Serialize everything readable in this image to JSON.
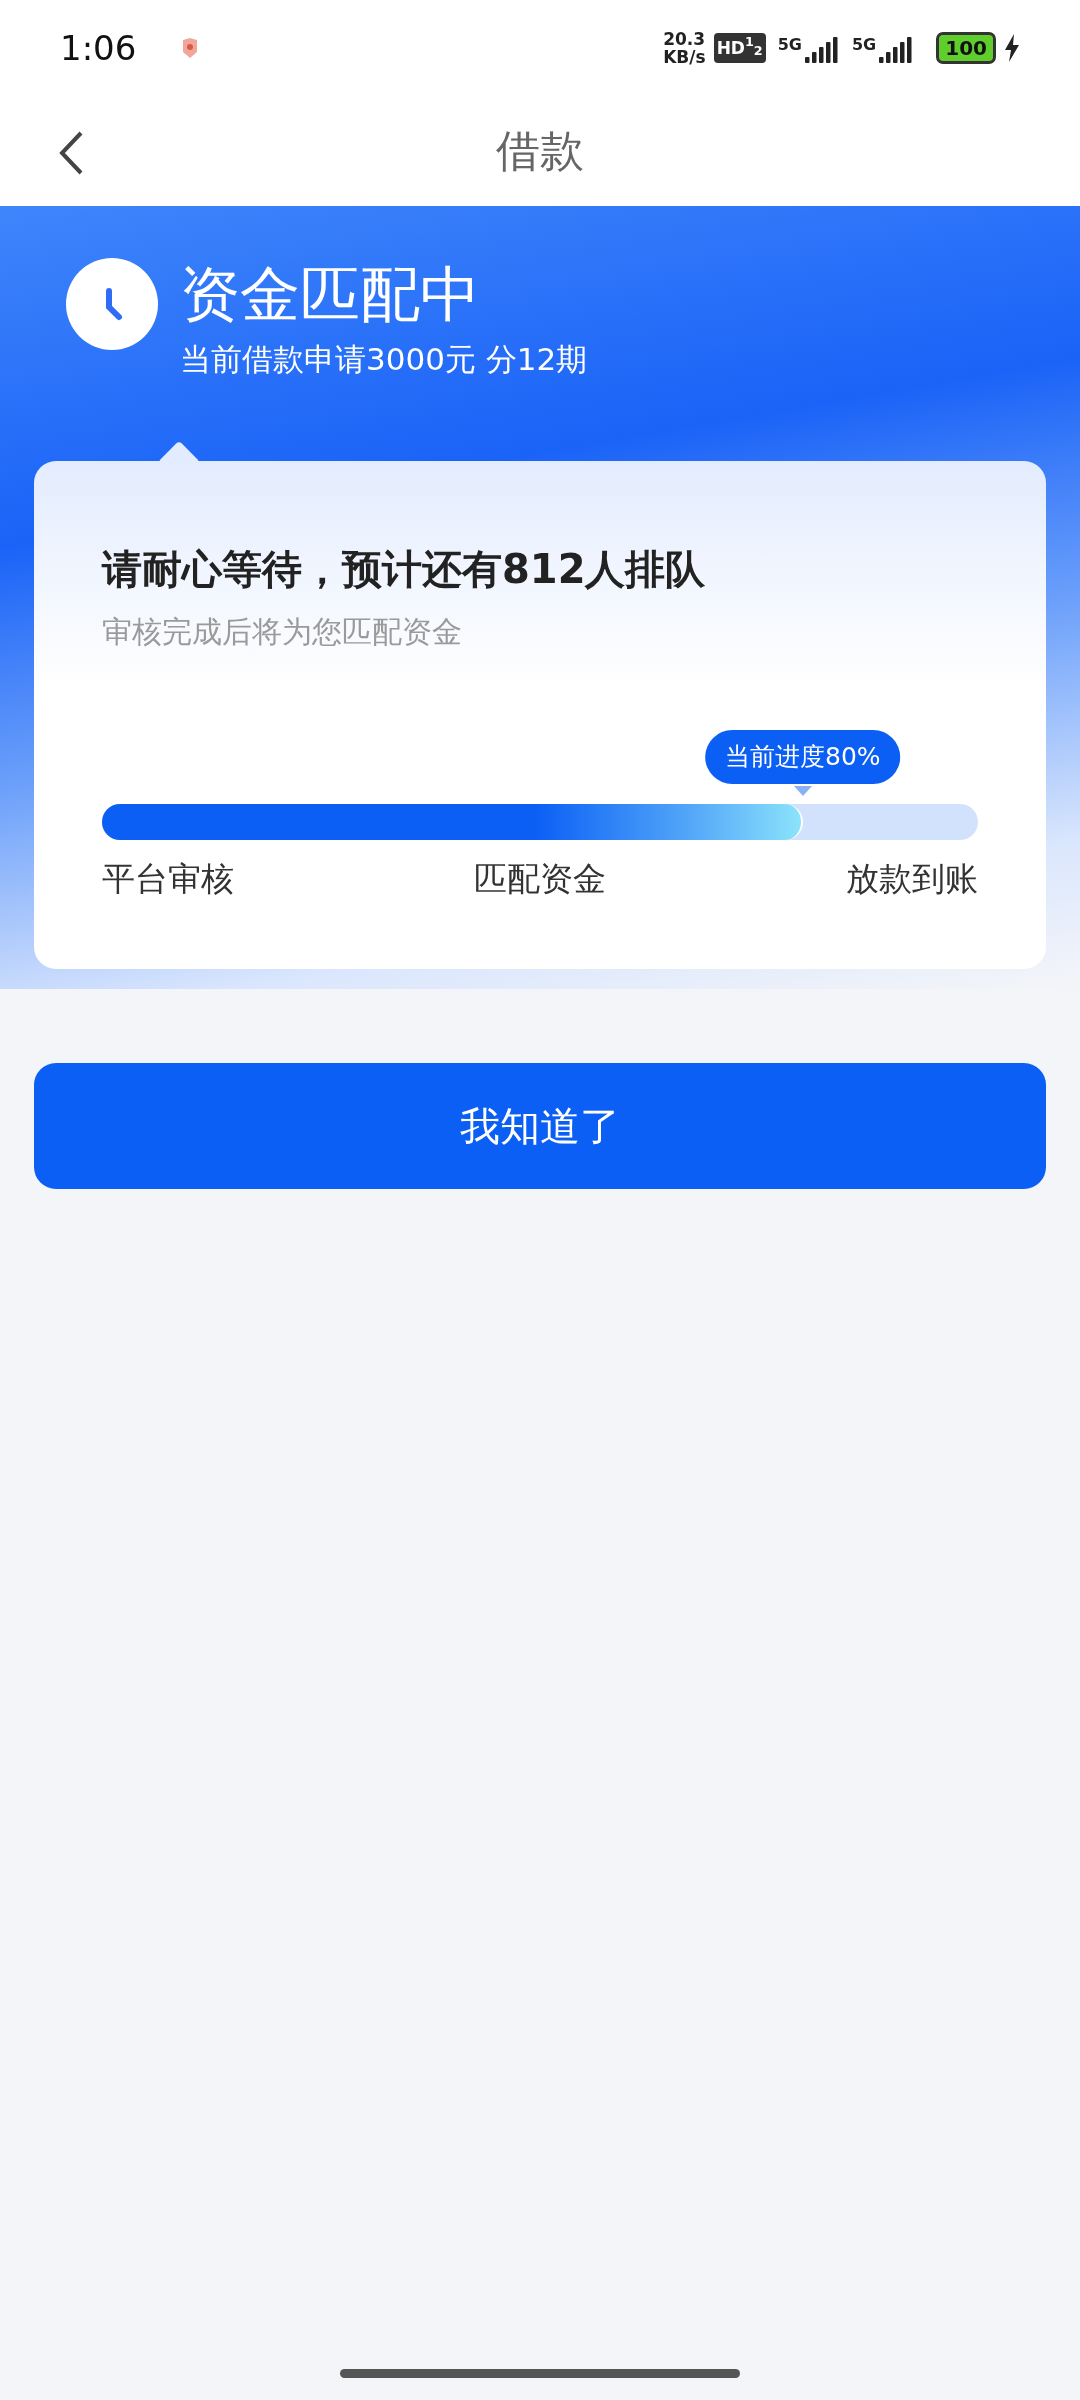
{
  "status_bar": {
    "time": "1:06",
    "speed": "20.3",
    "speed_unit": "KB/s",
    "hd": "HD$^{1}$$_{2}$",
    "networks": [
      "5G",
      "5G"
    ],
    "battery": "100"
  },
  "nav": {
    "title": "借款"
  },
  "header": {
    "title": "资金匹配中",
    "subtitle": "当前借款申请3000元 分12期"
  },
  "card": {
    "title": "请耐心等待，预计还有812人排队",
    "subtitle": "审核完成后将为您匹配资金",
    "progress": {
      "tooltip": "当前进度80%",
      "level": 0.8
    },
    "steps": [
      "平台审核",
      "匹配资金",
      "放款到账"
    ]
  },
  "button": "我知道了"
}
